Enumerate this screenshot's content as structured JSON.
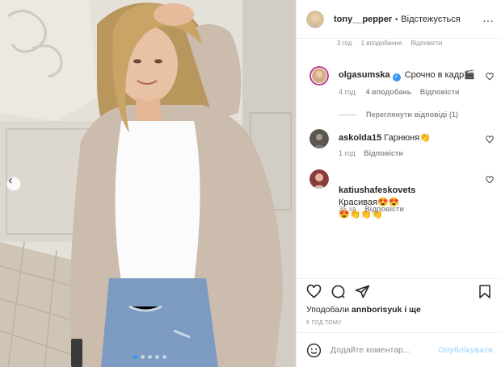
{
  "post": {
    "author": "tony__pepper",
    "separator": "•",
    "follow_status": "Відстежується",
    "more": "···"
  },
  "truncated_meta": [
    "3 год",
    "1 вподобання",
    "Відповісти"
  ],
  "comments": [
    {
      "user": "olgasumska",
      "verified": true,
      "text": "Срочно в кадр🎬",
      "time": "4 год.",
      "likes": "4 вподобань",
      "reply": "Відповісти",
      "view_replies": "Переглянути відповіді (1)"
    },
    {
      "user": "askolda15",
      "text": "Гарнюня👏",
      "time": "1 год",
      "reply": "Відповісти"
    },
    {
      "user": "katiushafeskovets",
      "text": "Красивая😍😍\n😍👏👏👏",
      "time": "35 хв",
      "reply": "Відповісти"
    }
  ],
  "actions": {
    "icons": [
      "heart-icon",
      "comment-icon",
      "share-icon",
      "bookmark-icon"
    ]
  },
  "likes": {
    "prefix": "Уподобали ",
    "user": "annborisyuk",
    "suffix": " і ще"
  },
  "timestamp": "6 ГОД ТОМУ",
  "add_comment": {
    "placeholder": "Додайте коментар...",
    "publish_label": "Опублікувати"
  },
  "carousel": {
    "slides": 5,
    "active_index": 0
  },
  "colors": {
    "accent": "#3897f0",
    "publish_disabled": "#b2dffc",
    "muted": "#8e8e8e"
  }
}
